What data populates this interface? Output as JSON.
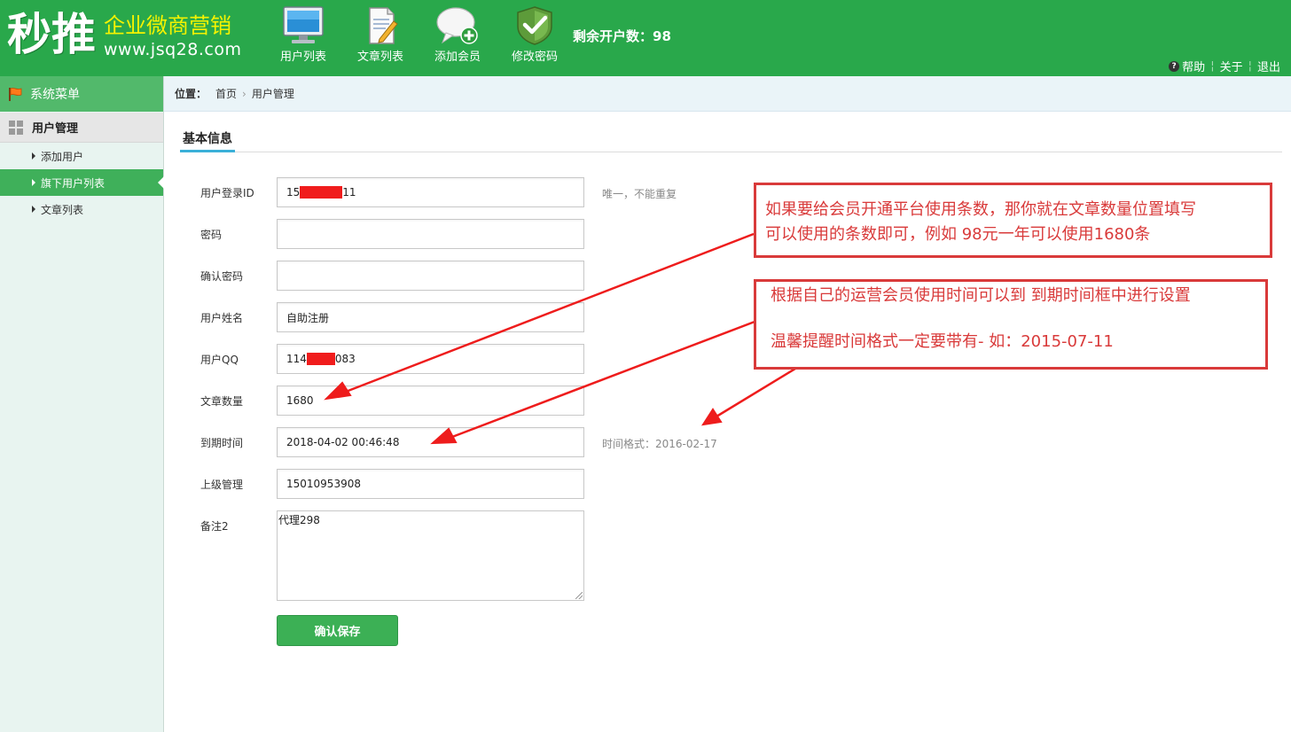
{
  "header": {
    "logo_big": "秒推",
    "logo_sub": "企业微商营销",
    "logo_url": "www.jsq28.com",
    "nav": [
      {
        "label": "用户列表",
        "icon": "monitor-icon"
      },
      {
        "label": "文章列表",
        "icon": "document-edit-icon"
      },
      {
        "label": "添加会员",
        "icon": "add-chat-icon"
      },
      {
        "label": "修改密码",
        "icon": "shield-check-icon"
      }
    ],
    "remaining": "剩余开户数：98",
    "links": {
      "help": "帮助",
      "about": "关于",
      "logout": "退出"
    }
  },
  "sidebar": {
    "title": "系统菜单",
    "group": "用户管理",
    "items": [
      {
        "label": "添加用户"
      },
      {
        "label": "旗下用户列表"
      },
      {
        "label": "文章列表"
      }
    ]
  },
  "breadcrumb": {
    "prefix": "位置：",
    "home": "首页",
    "sep": "›",
    "current": "用户管理"
  },
  "tab": {
    "label": "基本信息"
  },
  "form": {
    "login_id": {
      "label": "用户登录ID",
      "value_start": "15",
      "value_end": "11",
      "hint": "唯一，不能重复"
    },
    "password": {
      "label": "密码",
      "value": ""
    },
    "confirm_password": {
      "label": "确认密码",
      "value": ""
    },
    "name": {
      "label": "用户姓名",
      "value": "自助注册"
    },
    "qq": {
      "label": "用户QQ",
      "value_start": "114",
      "value_end": "083"
    },
    "article_count": {
      "label": "文章数量",
      "value": "1680"
    },
    "expire": {
      "label": "到期时间",
      "value": "2018-04-02 00:46:48",
      "hint": "时间格式：2016-02-17"
    },
    "manager": {
      "label": "上级管理",
      "value": "15010953908"
    },
    "remark": {
      "label": "备注2",
      "value": "代理298"
    },
    "save": "确认保存"
  },
  "notes": {
    "note1_line1": "如果要给会员开通平台使用条数，那你就在文章数量位置填写",
    "note1_line2": "可以使用的条数即可，例如 98元一年可以使用1680条",
    "note2_line1": "根据自己的运营会员使用时间可以到 到期时间框中进行设置",
    "note2_line2": "温馨提醒时间格式一定要带有-  如：2015-07-11"
  },
  "colors": {
    "header_green": "#29a84b",
    "accent_yellow": "#f5f300",
    "annotation_red": "#d93a3a",
    "redaction": "#f01c1c"
  }
}
